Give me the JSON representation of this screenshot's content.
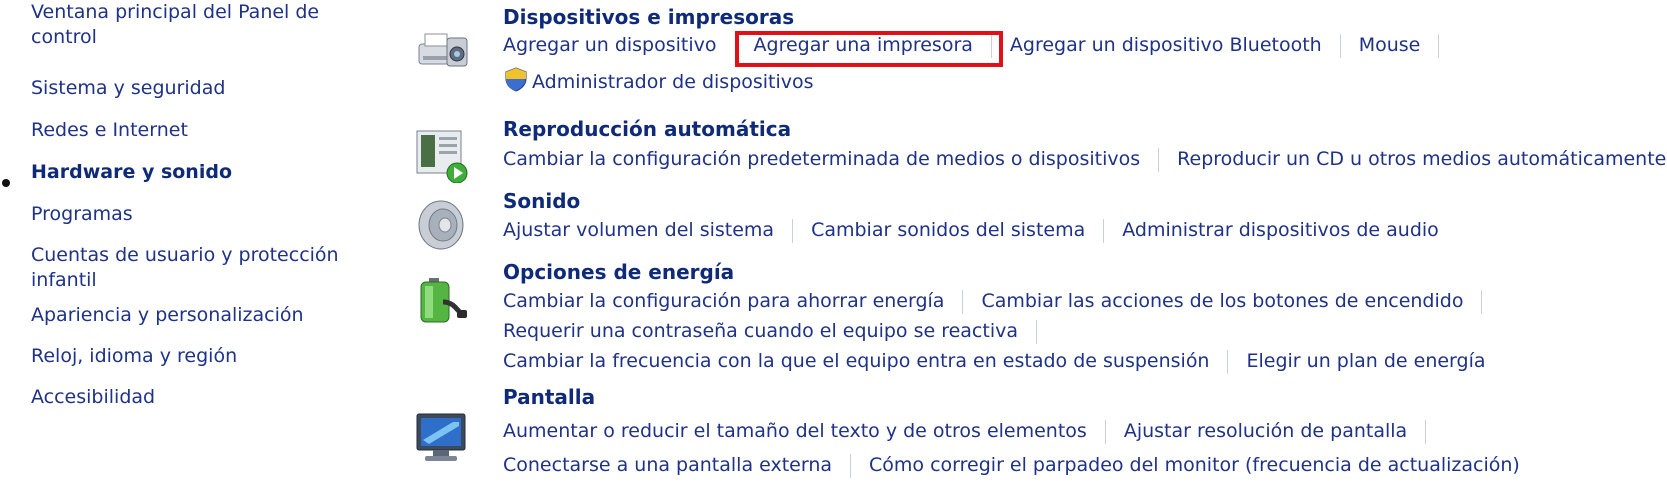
{
  "sidebar": {
    "items": [
      {
        "label": "Ventana principal del Panel de control"
      },
      {
        "label": "Sistema y seguridad"
      },
      {
        "label": "Redes e Internet"
      },
      {
        "label": "Hardware y sonido"
      },
      {
        "label": "Programas"
      },
      {
        "label": "Cuentas de usuario y protección infantil"
      },
      {
        "label": "Apariencia y personalización"
      },
      {
        "label": "Reloj, idioma y región"
      },
      {
        "label": "Accesibilidad"
      }
    ]
  },
  "sections": [
    {
      "title": "Dispositivos e impresoras",
      "icon": "printer-camera-icon",
      "links": [
        "Agregar un dispositivo",
        "Agregar una impresora",
        "Agregar un dispositivo Bluetooth",
        "Mouse",
        "Administrador de dispositivos"
      ]
    },
    {
      "title": "Reproducción automática",
      "icon": "autoplay-icon",
      "links": [
        "Cambiar la configuración predeterminada de medios o dispositivos",
        "Reproducir un CD u otros medios automáticamente"
      ]
    },
    {
      "title": "Sonido",
      "icon": "speaker-icon",
      "links": [
        "Ajustar volumen del sistema",
        "Cambiar sonidos del sistema",
        "Administrar dispositivos de audio"
      ]
    },
    {
      "title": "Opciones de energía",
      "icon": "battery-plug-icon",
      "links": [
        "Cambiar la configuración para ahorrar energía",
        "Cambiar las acciones de los botones de encendido",
        "Requerir una contraseña cuando el equipo se reactiva",
        "Cambiar la frecuencia con la que el equipo entra en estado de suspensión",
        "Elegir un plan de energía"
      ]
    },
    {
      "title": "Pantalla",
      "icon": "monitor-icon",
      "links": [
        "Aumentar o reducir el tamaño del texto y de otros elementos",
        "Ajustar resolución de pantalla",
        "Conectarse a una pantalla externa",
        "Cómo corregir el parpadeo del monitor (frecuencia de actualización)"
      ]
    }
  ],
  "colors": {
    "link": "#1e3287",
    "heading": "#0e2a78",
    "highlight_border": "#e01017",
    "separator": "#c9cfdc"
  }
}
